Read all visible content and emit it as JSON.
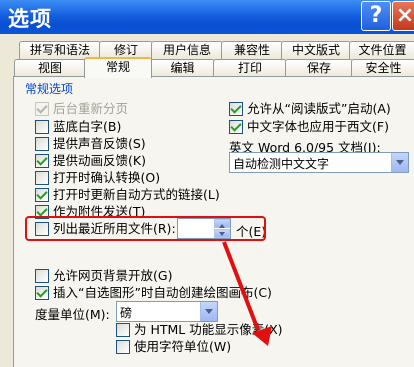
{
  "window": {
    "title": "选项",
    "help_label": "?",
    "close_label": "×"
  },
  "tabs_row1": [
    {
      "label": "拼写和语法"
    },
    {
      "label": "修订"
    },
    {
      "label": "用户信息"
    },
    {
      "label": "兼容性"
    },
    {
      "label": "中文版式"
    },
    {
      "label": "文件位置"
    }
  ],
  "tabs_row2": [
    {
      "label": "视图"
    },
    {
      "label": "常规",
      "active": true
    },
    {
      "label": "编辑"
    },
    {
      "label": "打印"
    },
    {
      "label": "保存"
    },
    {
      "label": "安全性"
    }
  ],
  "section": {
    "label": "常规选项"
  },
  "left_options": [
    {
      "label": "后台重新分页",
      "checked": true,
      "disabled": true
    },
    {
      "label": "蓝底白字(B)",
      "checked": false
    },
    {
      "label": "提供声音反馈(S)",
      "checked": false
    },
    {
      "label": "提供动画反馈(K)",
      "checked": true
    },
    {
      "label": "打开时确认转换(O)",
      "checked": false
    },
    {
      "label": "打开时更新自动方式的链接(L)",
      "checked": true
    },
    {
      "label": "作为附件发送(T)",
      "checked": true
    },
    {
      "label": "列出最近所用文件(R):",
      "checked": false
    }
  ],
  "right_options": [
    {
      "label": "允许从“阅读版式”启动(A)",
      "checked": true
    },
    {
      "label": "中文字体也应用于西文(F)",
      "checked": true
    }
  ],
  "english_doc": {
    "label": "英文 Word 6.0/95 文档(I):",
    "value": "自动检测中文文字"
  },
  "recent_files": {
    "value": "",
    "unit_label": "个(E)"
  },
  "lower_options": [
    {
      "label": "允许网页背景开放(G)",
      "checked": false
    },
    {
      "label": "插入“自选图形”时自动创建绘图画布(C)",
      "checked": true
    }
  ],
  "measure": {
    "label": "度量单位(M):",
    "value": "磅"
  },
  "html_option": {
    "label": "为 HTML 功能显示像素(X)",
    "checked": false
  },
  "bottom_option": {
    "label": "使用字符单位(W)",
    "checked": false
  },
  "annotation_color": "#e01010"
}
